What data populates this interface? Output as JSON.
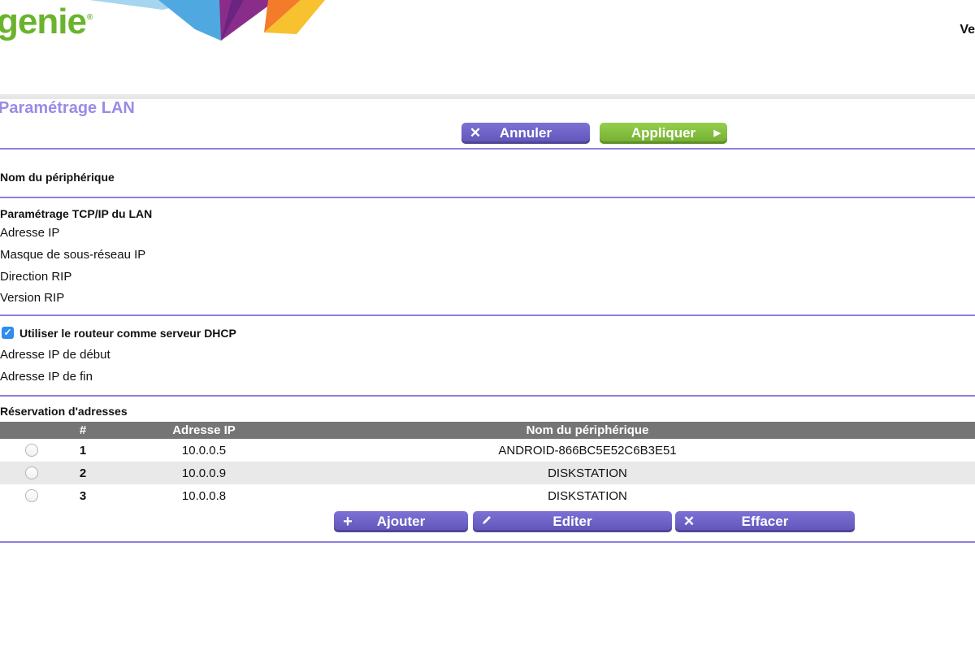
{
  "header": {
    "logo_text": "genie",
    "logo_mark": "®",
    "right_text": "Ve"
  },
  "page_title": "Paramétrage LAN",
  "actions": {
    "cancel_label": "Annuler",
    "cancel_icon": "close-icon",
    "apply_label": "Appliquer",
    "apply_icon": "arrow-right-icon"
  },
  "device_section": {
    "label": "Nom du périphérique"
  },
  "tcpip_section": {
    "title": "Paramétrage TCP/IP du LAN",
    "fields": [
      {
        "label": "Adresse IP"
      },
      {
        "label": "Masque de sous-réseau IP"
      },
      {
        "label": "Direction RIP"
      },
      {
        "label": "Version RIP"
      }
    ]
  },
  "dhcp_section": {
    "checkbox_label": "Utiliser le routeur comme serveur DHCP",
    "checked": true,
    "fields": [
      {
        "label": "Adresse IP de début"
      },
      {
        "label": "Adresse IP de fin"
      }
    ]
  },
  "reservation": {
    "title": "Réservation d'adresses",
    "columns": [
      "#",
      "Adresse IP",
      "Nom du périphérique"
    ],
    "rows": [
      {
        "num": "1",
        "ip": "10.0.0.5",
        "name": "ANDROID-866BC5E52C6B3E51"
      },
      {
        "num": "2",
        "ip": "10.0.0.9",
        "name": "DISKSTATION"
      },
      {
        "num": "3",
        "ip": "10.0.0.8",
        "name": "DISKSTATION"
      }
    ],
    "buttons": {
      "add_label": "Ajouter",
      "add_icon": "plus-icon",
      "edit_label": "Editer",
      "edit_icon": "pencil-icon",
      "delete_label": "Effacer",
      "delete_icon": "close-icon"
    }
  },
  "colors": {
    "accent": "#8a7fe0",
    "title": "#9b8ae6",
    "button_purple": "#6a5fc4",
    "button_green": "#82bf3e",
    "logo_green": "#6ab42d",
    "table_header": "#757575",
    "checkbox": "#2f8cf0"
  }
}
